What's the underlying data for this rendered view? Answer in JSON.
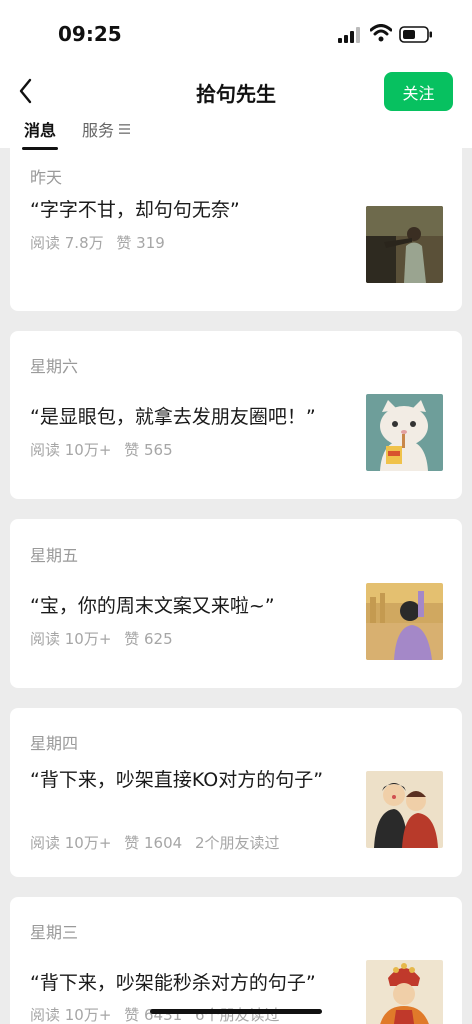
{
  "status": {
    "time": "09:25",
    "icons": [
      "signal-icon",
      "wifi-icon",
      "battery-icon"
    ]
  },
  "nav": {
    "title": "拾句先生",
    "follow_label": "关注",
    "back_icon": "chevron-left-icon"
  },
  "tabs": {
    "messages": "消息",
    "services": "服务",
    "services_icon": "menu-icon"
  },
  "colors": {
    "accent": "#07c160",
    "card_bg": "#ffffff",
    "page_bg": "#ececec",
    "muted_text": "#a6a6a6"
  },
  "articles": [
    {
      "date": "昨天",
      "title": "“字字不甘，却句句无奈”",
      "reads": "阅读 7.8万",
      "likes": "赞 319",
      "friends": ""
    },
    {
      "date": "星期六",
      "title": "“是显眼包，就拿去发朋友圈吧！”",
      "reads": "阅读 10万+",
      "likes": "赞 565",
      "friends": ""
    },
    {
      "date": "星期五",
      "title": "“宝，你的周末文案又来啦~”",
      "reads": "阅读 10万+",
      "likes": "赞 625",
      "friends": ""
    },
    {
      "date": "星期四",
      "title": "“背下来，吵架直接KO对方的句子”",
      "reads": "阅读 10万+",
      "likes": "赞 1604",
      "friends": "2个朋友读过"
    },
    {
      "date": "星期三",
      "title": "“背下来，吵架能秒杀对方的句子”",
      "reads": "阅读 10万+",
      "likes": "赞 6431",
      "friends": "6个朋友读过"
    }
  ]
}
